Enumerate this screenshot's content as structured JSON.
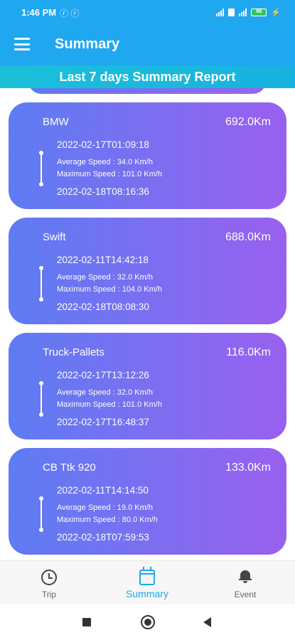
{
  "status_bar": {
    "time": "1:46 PM",
    "left_icons": "ⓡ ⓡ",
    "battery_level": "68"
  },
  "app_bar": {
    "title": "Summary"
  },
  "sub_header": {
    "title": "Last 7 days Summary Report"
  },
  "trips": [
    {
      "name": "BMW",
      "distance": "692.0Km",
      "start": "2022-02-17T01:09:18",
      "avg_speed": "Average Speed : 34.0 Km/h",
      "max_speed": "Maximum Speed : 101.0 Km/h",
      "end": "2022-02-18T08:16:36"
    },
    {
      "name": "Swift",
      "distance": "688.0Km",
      "start": "2022-02-11T14:42:18",
      "avg_speed": "Average Speed : 32.0 Km/h",
      "max_speed": "Maximum Speed : 104.0 Km/h",
      "end": "2022-02-18T08:08:30"
    },
    {
      "name": "Truck-Pallets",
      "distance": "116.0Km",
      "start": "2022-02-17T13:12:26",
      "avg_speed": "Average Speed : 32.0 Km/h",
      "max_speed": "Maximum Speed : 101.0 Km/h",
      "end": "2022-02-17T16:48:37"
    },
    {
      "name": "CB Ttk 920",
      "distance": "133.0Km",
      "start": "2022-02-11T14:14:50",
      "avg_speed": "Average Speed : 19.0 Km/h",
      "max_speed": "Maximum Speed : 80.0 Km/h",
      "end": "2022-02-18T07:59:53"
    }
  ],
  "bottom_nav": {
    "items": [
      {
        "label": "Trip",
        "icon": "clock-icon"
      },
      {
        "label": "Summary",
        "icon": "calendar-icon",
        "active": true
      },
      {
        "label": "Event",
        "icon": "bell-icon"
      }
    ]
  },
  "colors": {
    "primary": "#1fa7f0",
    "card_gradient_start": "#5d7cf3",
    "card_gradient_end": "#9960ef"
  }
}
